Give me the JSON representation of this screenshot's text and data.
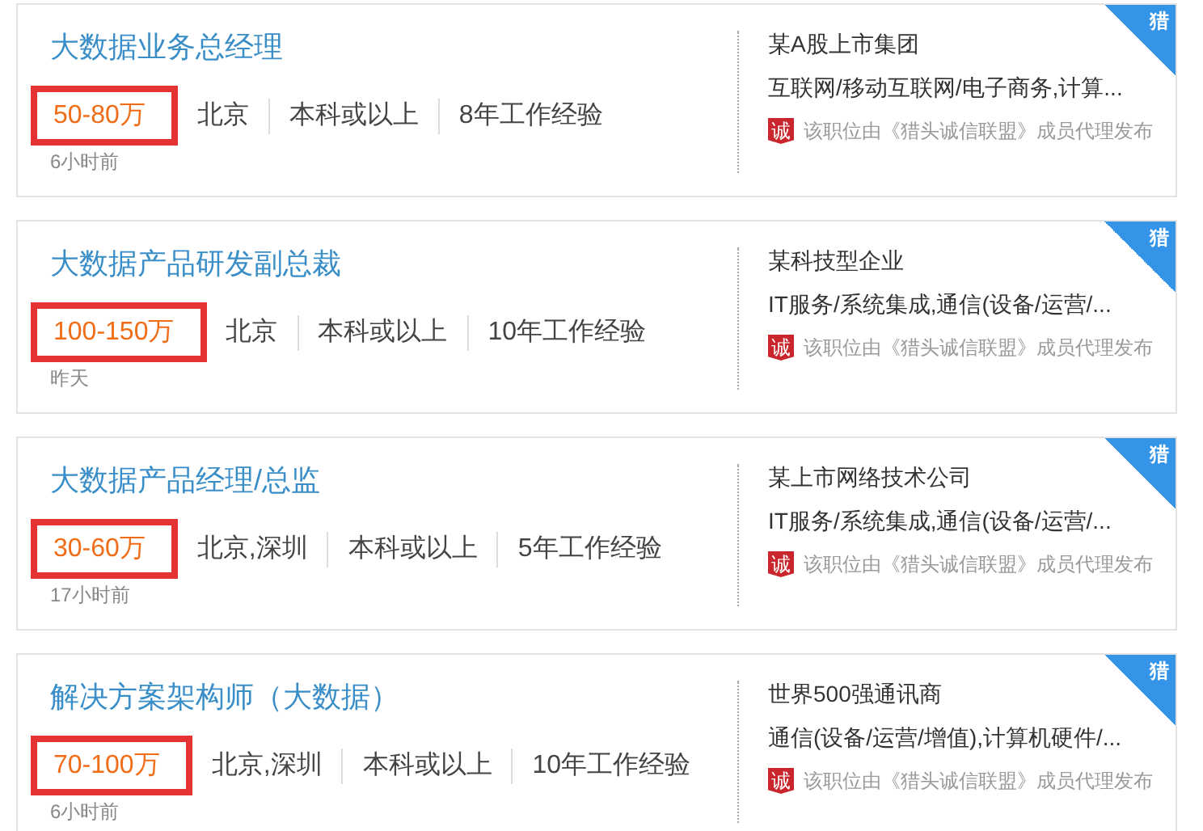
{
  "jobs": [
    {
      "title": "大数据业务总经理",
      "salary": "50-80万",
      "highlighted": true,
      "tags": [
        "北京",
        "本科或以上",
        "8年工作经验"
      ],
      "time": "6小时前",
      "company": "某A股上市集团",
      "industry": "互联网/移动互联网/电子商务,计算...",
      "badge": "诚",
      "note": "该职位由《猎头诚信联盟》成员代理发布",
      "corner": "猎"
    },
    {
      "title": "大数据产品研发副总裁",
      "salary": "100-150万",
      "highlighted": true,
      "tags": [
        "北京",
        "本科或以上",
        "10年工作经验"
      ],
      "time": "昨天",
      "company": "某科技型企业",
      "industry": "IT服务/系统集成,通信(设备/运营/...",
      "badge": "诚",
      "note": "该职位由《猎头诚信联盟》成员代理发布",
      "corner": "猎"
    },
    {
      "title": "大数据产品经理/总监",
      "salary": "30-60万",
      "highlighted": true,
      "tags": [
        "北京,深圳",
        "本科或以上",
        "5年工作经验"
      ],
      "time": "17小时前",
      "company": "某上市网络技术公司",
      "industry": "IT服务/系统集成,通信(设备/运营/...",
      "badge": "诚",
      "note": "该职位由《猎头诚信联盟》成员代理发布",
      "corner": "猎"
    },
    {
      "title": "解决方案架构师（大数据）",
      "salary": "70-100万",
      "highlighted": true,
      "tags": [
        "北京,深圳",
        "本科或以上",
        "10年工作经验"
      ],
      "time": "6小时前",
      "company": "世界500强通讯商",
      "industry": "通信(设备/运营/增值),计算机硬件/...",
      "badge": "诚",
      "note": "该职位由《猎头诚信联盟》成员代理发布",
      "corner": "猎"
    }
  ]
}
